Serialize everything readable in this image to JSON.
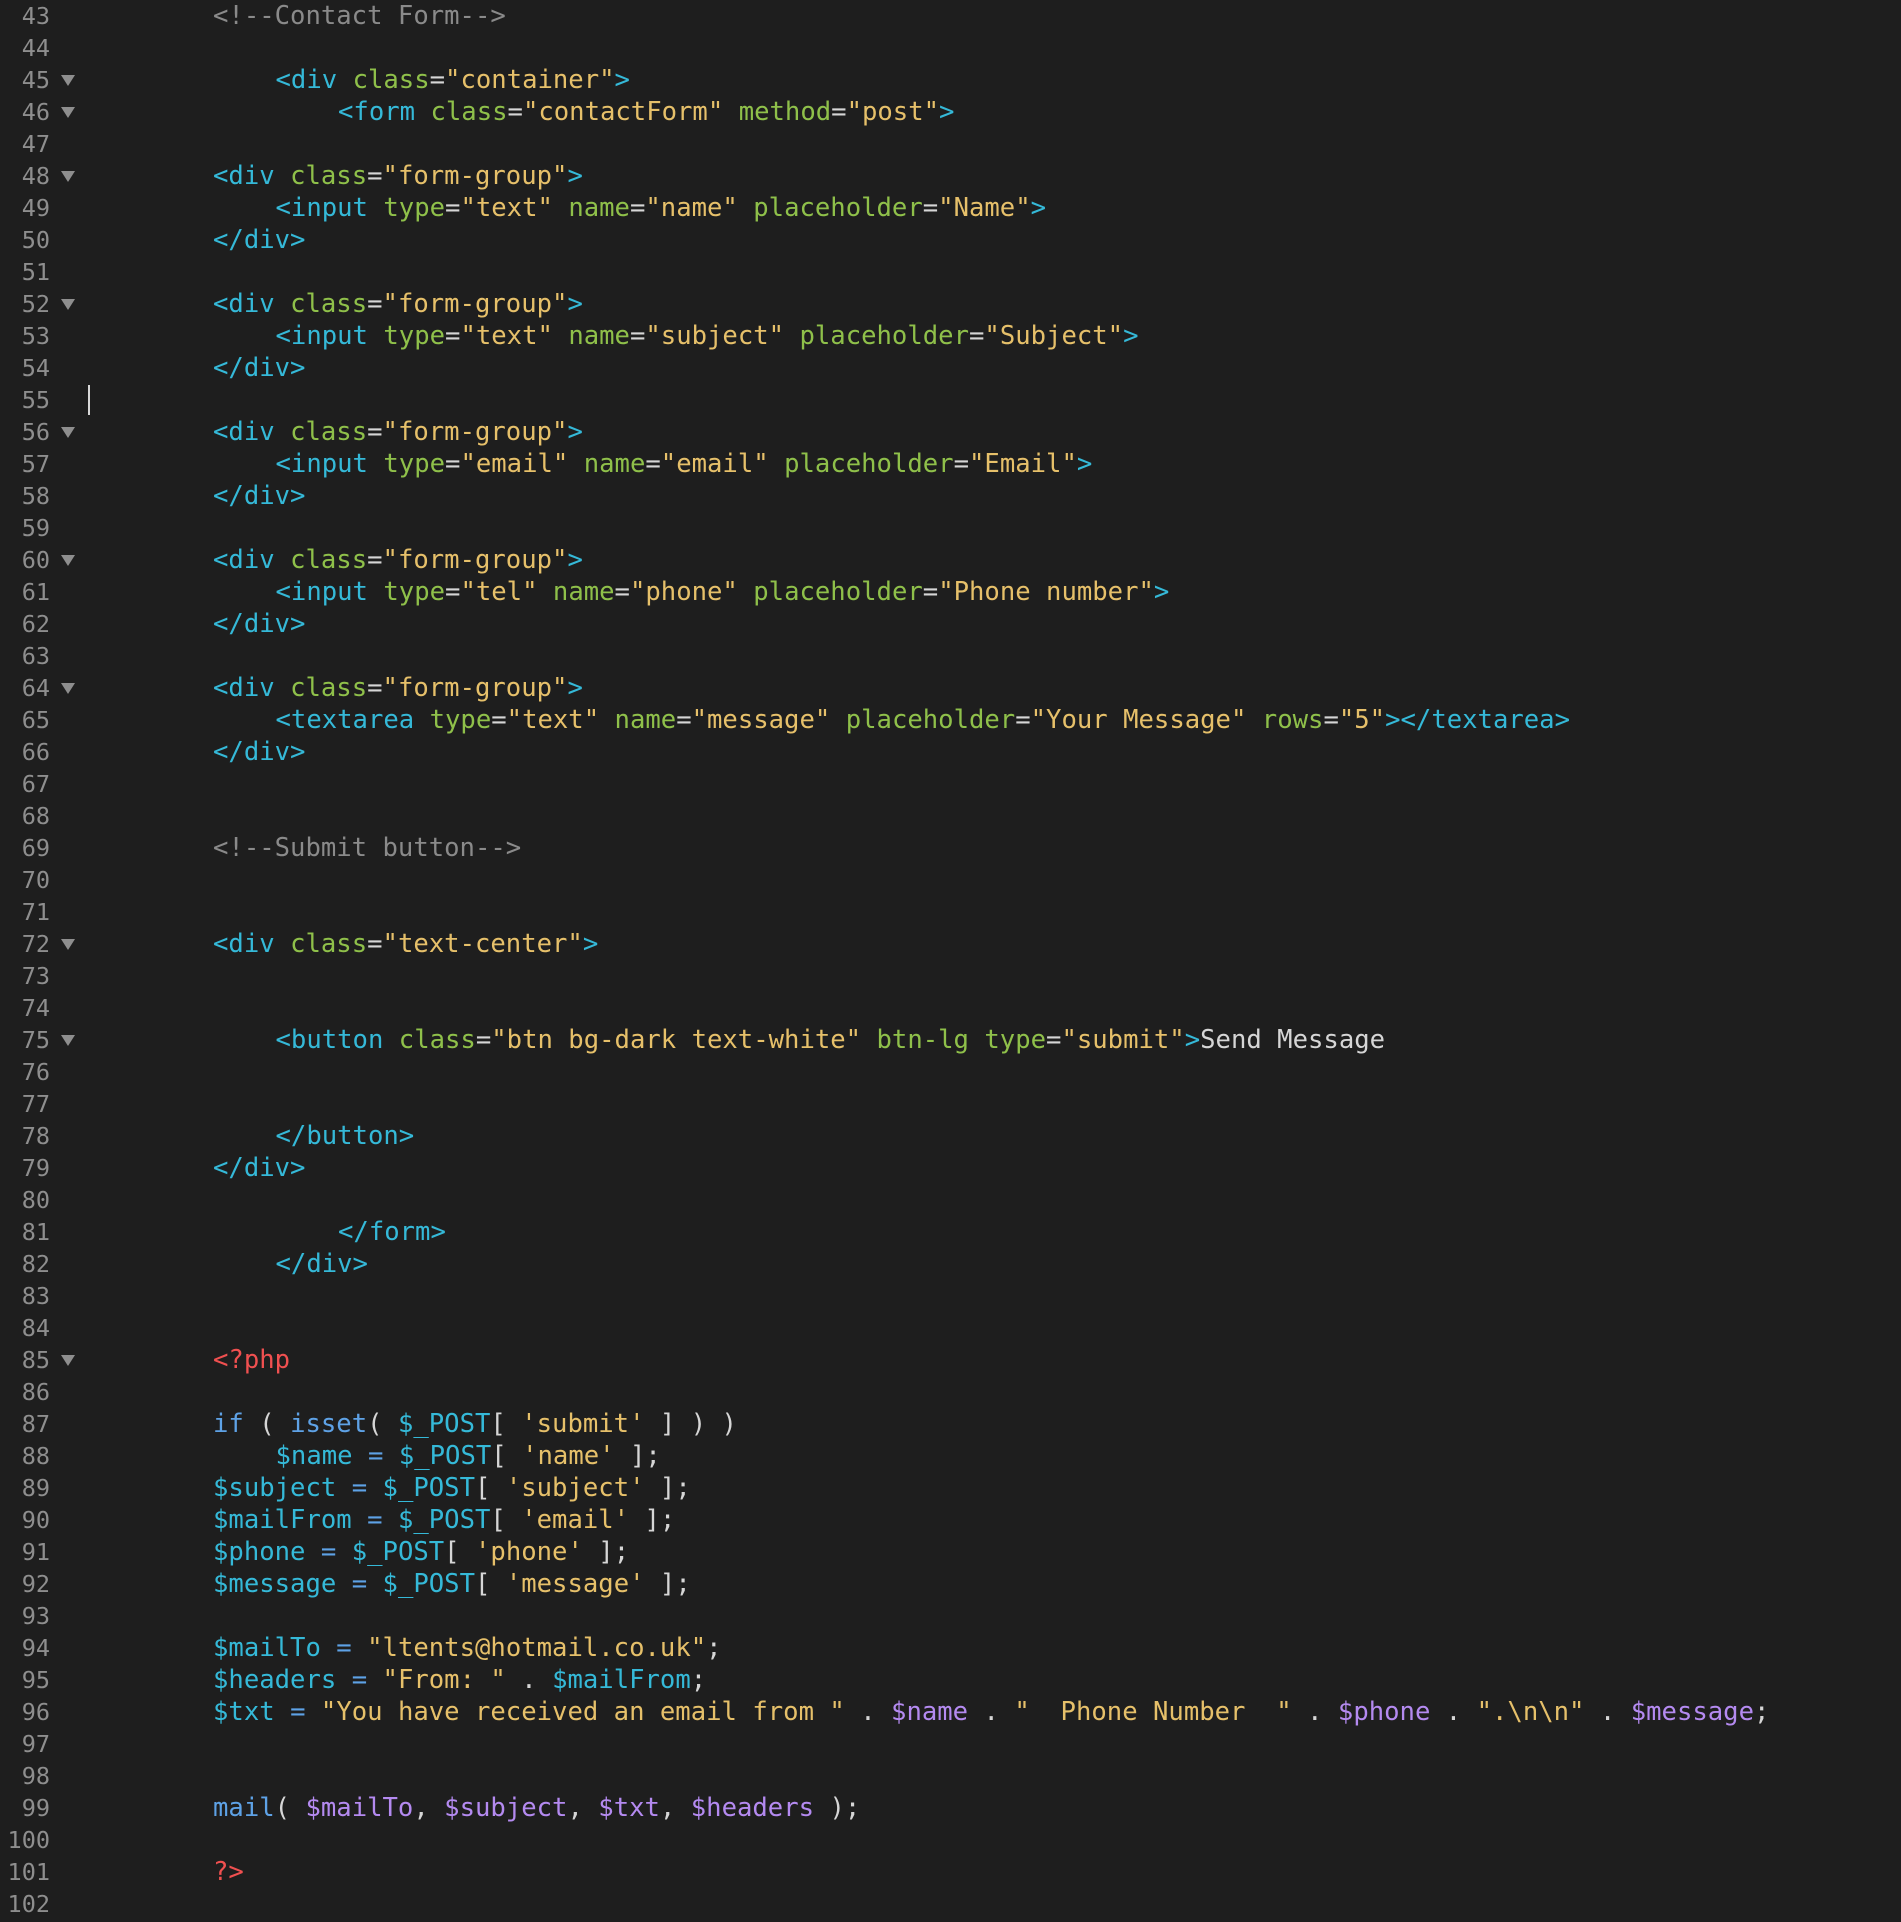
{
  "colors": {
    "background": "#1e1e1e",
    "line_number": "#8e8e8e",
    "plain": "#d6d6d6",
    "comment": "#8a8a8a",
    "tag": "#35b9d8",
    "attribute": "#8fc04a",
    "string": "#e6c06a",
    "php_tag": "#f05050",
    "keyword": "#5ea2e6",
    "variable": "#b48af0"
  },
  "lines": [
    {
      "number": "43",
      "indent": 2,
      "fold": false,
      "tokens": [
        [
          "c",
          "<!--Contact Form-->"
        ]
      ]
    },
    {
      "number": "44",
      "indent": 0,
      "fold": false,
      "tokens": []
    },
    {
      "number": "45",
      "indent": 3,
      "fold": true,
      "tokens": [
        [
          "t",
          "<div"
        ],
        [
          "p",
          " "
        ],
        [
          "a",
          "class"
        ],
        [
          "p",
          "="
        ],
        [
          "s",
          "\"container\""
        ],
        [
          "t",
          ">"
        ]
      ]
    },
    {
      "number": "46",
      "indent": 4,
      "fold": true,
      "tokens": [
        [
          "t",
          "<form"
        ],
        [
          "p",
          " "
        ],
        [
          "a",
          "class"
        ],
        [
          "p",
          "="
        ],
        [
          "s",
          "\"contactForm\""
        ],
        [
          "p",
          " "
        ],
        [
          "a",
          "method"
        ],
        [
          "p",
          "="
        ],
        [
          "s",
          "\"post\""
        ],
        [
          "t",
          ">"
        ]
      ]
    },
    {
      "number": "47",
      "indent": 0,
      "fold": false,
      "tokens": []
    },
    {
      "number": "48",
      "indent": 2,
      "fold": true,
      "tokens": [
        [
          "t",
          "<div"
        ],
        [
          "p",
          " "
        ],
        [
          "a",
          "class"
        ],
        [
          "p",
          "="
        ],
        [
          "s",
          "\"form-group\""
        ],
        [
          "t",
          ">"
        ]
      ]
    },
    {
      "number": "49",
      "indent": 3,
      "fold": false,
      "tokens": [
        [
          "t",
          "<input"
        ],
        [
          "p",
          " "
        ],
        [
          "a",
          "type"
        ],
        [
          "p",
          "="
        ],
        [
          "s",
          "\"text\""
        ],
        [
          "p",
          " "
        ],
        [
          "a",
          "name"
        ],
        [
          "p",
          "="
        ],
        [
          "s",
          "\"name\""
        ],
        [
          "p",
          " "
        ],
        [
          "a",
          "placeholder"
        ],
        [
          "p",
          "="
        ],
        [
          "s",
          "\"Name\""
        ],
        [
          "t",
          ">"
        ]
      ]
    },
    {
      "number": "50",
      "indent": 2,
      "fold": false,
      "tokens": [
        [
          "t",
          "</div>"
        ]
      ]
    },
    {
      "number": "51",
      "indent": 0,
      "fold": false,
      "tokens": []
    },
    {
      "number": "52",
      "indent": 2,
      "fold": true,
      "tokens": [
        [
          "t",
          "<div"
        ],
        [
          "p",
          " "
        ],
        [
          "a",
          "class"
        ],
        [
          "p",
          "="
        ],
        [
          "s",
          "\"form-group\""
        ],
        [
          "t",
          ">"
        ]
      ]
    },
    {
      "number": "53",
      "indent": 3,
      "fold": false,
      "tokens": [
        [
          "t",
          "<input"
        ],
        [
          "p",
          " "
        ],
        [
          "a",
          "type"
        ],
        [
          "p",
          "="
        ],
        [
          "s",
          "\"text\""
        ],
        [
          "p",
          " "
        ],
        [
          "a",
          "name"
        ],
        [
          "p",
          "="
        ],
        [
          "s",
          "\"subject\""
        ],
        [
          "p",
          " "
        ],
        [
          "a",
          "placeholder"
        ],
        [
          "p",
          "="
        ],
        [
          "s",
          "\"Subject\""
        ],
        [
          "t",
          ">"
        ]
      ]
    },
    {
      "number": "54",
      "indent": 2,
      "fold": false,
      "tokens": [
        [
          "t",
          "</div>"
        ]
      ]
    },
    {
      "number": "55",
      "indent": 0,
      "fold": false,
      "cursor": true,
      "tokens": []
    },
    {
      "number": "56",
      "indent": 2,
      "fold": true,
      "tokens": [
        [
          "t",
          "<div"
        ],
        [
          "p",
          " "
        ],
        [
          "a",
          "class"
        ],
        [
          "p",
          "="
        ],
        [
          "s",
          "\"form-group\""
        ],
        [
          "t",
          ">"
        ]
      ]
    },
    {
      "number": "57",
      "indent": 3,
      "fold": false,
      "tokens": [
        [
          "t",
          "<input"
        ],
        [
          "p",
          " "
        ],
        [
          "a",
          "type"
        ],
        [
          "p",
          "="
        ],
        [
          "s",
          "\"email\""
        ],
        [
          "p",
          " "
        ],
        [
          "a",
          "name"
        ],
        [
          "p",
          "="
        ],
        [
          "s",
          "\"email\""
        ],
        [
          "p",
          " "
        ],
        [
          "a",
          "placeholder"
        ],
        [
          "p",
          "="
        ],
        [
          "s",
          "\"Email\""
        ],
        [
          "t",
          ">"
        ]
      ]
    },
    {
      "number": "58",
      "indent": 2,
      "fold": false,
      "tokens": [
        [
          "t",
          "</div>"
        ]
      ]
    },
    {
      "number": "59",
      "indent": 0,
      "fold": false,
      "tokens": []
    },
    {
      "number": "60",
      "indent": 2,
      "fold": true,
      "tokens": [
        [
          "t",
          "<div"
        ],
        [
          "p",
          " "
        ],
        [
          "a",
          "class"
        ],
        [
          "p",
          "="
        ],
        [
          "s",
          "\"form-group\""
        ],
        [
          "t",
          ">"
        ]
      ]
    },
    {
      "number": "61",
      "indent": 3,
      "fold": false,
      "tokens": [
        [
          "t",
          "<input"
        ],
        [
          "p",
          " "
        ],
        [
          "a",
          "type"
        ],
        [
          "p",
          "="
        ],
        [
          "s",
          "\"tel\""
        ],
        [
          "p",
          " "
        ],
        [
          "a",
          "name"
        ],
        [
          "p",
          "="
        ],
        [
          "s",
          "\"phone\""
        ],
        [
          "p",
          " "
        ],
        [
          "a",
          "placeholder"
        ],
        [
          "p",
          "="
        ],
        [
          "s",
          "\"Phone number\""
        ],
        [
          "t",
          ">"
        ]
      ]
    },
    {
      "number": "62",
      "indent": 2,
      "fold": false,
      "tokens": [
        [
          "t",
          "</div>"
        ]
      ]
    },
    {
      "number": "63",
      "indent": 0,
      "fold": false,
      "tokens": []
    },
    {
      "number": "64",
      "indent": 2,
      "fold": true,
      "tokens": [
        [
          "t",
          "<div"
        ],
        [
          "p",
          " "
        ],
        [
          "a",
          "class"
        ],
        [
          "p",
          "="
        ],
        [
          "s",
          "\"form-group\""
        ],
        [
          "t",
          ">"
        ]
      ]
    },
    {
      "number": "65",
      "indent": 3,
      "fold": false,
      "tokens": [
        [
          "t",
          "<textarea"
        ],
        [
          "p",
          " "
        ],
        [
          "a",
          "type"
        ],
        [
          "p",
          "="
        ],
        [
          "s",
          "\"text\""
        ],
        [
          "p",
          " "
        ],
        [
          "a",
          "name"
        ],
        [
          "p",
          "="
        ],
        [
          "s",
          "\"message\""
        ],
        [
          "p",
          " "
        ],
        [
          "a",
          "placeholder"
        ],
        [
          "p",
          "="
        ],
        [
          "s",
          "\"Your Message\""
        ],
        [
          "p",
          " "
        ],
        [
          "a",
          "rows"
        ],
        [
          "p",
          "="
        ],
        [
          "s",
          "\"5\""
        ],
        [
          "t",
          "></textarea>"
        ]
      ]
    },
    {
      "number": "66",
      "indent": 2,
      "fold": false,
      "tokens": [
        [
          "t",
          "</div>"
        ]
      ]
    },
    {
      "number": "67",
      "indent": 0,
      "fold": false,
      "tokens": []
    },
    {
      "number": "68",
      "indent": 0,
      "fold": false,
      "tokens": []
    },
    {
      "number": "69",
      "indent": 2,
      "fold": false,
      "tokens": [
        [
          "c",
          "<!--Submit button-->"
        ]
      ]
    },
    {
      "number": "70",
      "indent": 0,
      "fold": false,
      "tokens": []
    },
    {
      "number": "71",
      "indent": 0,
      "fold": false,
      "tokens": []
    },
    {
      "number": "72",
      "indent": 2,
      "fold": true,
      "tokens": [
        [
          "t",
          "<div"
        ],
        [
          "p",
          " "
        ],
        [
          "a",
          "class"
        ],
        [
          "p",
          "="
        ],
        [
          "s",
          "\"text-center\""
        ],
        [
          "t",
          ">"
        ]
      ]
    },
    {
      "number": "73",
      "indent": 0,
      "fold": false,
      "tokens": []
    },
    {
      "number": "74",
      "indent": 0,
      "fold": false,
      "tokens": []
    },
    {
      "number": "75",
      "indent": 3,
      "fold": true,
      "tokens": [
        [
          "t",
          "<button"
        ],
        [
          "p",
          " "
        ],
        [
          "a",
          "class"
        ],
        [
          "p",
          "="
        ],
        [
          "s",
          "\"btn bg-dark text-white\""
        ],
        [
          "p",
          " "
        ],
        [
          "a",
          "btn-lg"
        ],
        [
          "p",
          " "
        ],
        [
          "a",
          "type"
        ],
        [
          "p",
          "="
        ],
        [
          "s",
          "\"submit\""
        ],
        [
          "t",
          ">"
        ],
        [
          "p",
          "Send Message"
        ]
      ]
    },
    {
      "number": "76",
      "indent": 0,
      "fold": false,
      "tokens": []
    },
    {
      "number": "77",
      "indent": 0,
      "fold": false,
      "tokens": []
    },
    {
      "number": "78",
      "indent": 3,
      "fold": false,
      "tokens": [
        [
          "t",
          "</button>"
        ]
      ]
    },
    {
      "number": "79",
      "indent": 2,
      "fold": false,
      "tokens": [
        [
          "t",
          "</div>"
        ]
      ]
    },
    {
      "number": "80",
      "indent": 0,
      "fold": false,
      "tokens": []
    },
    {
      "number": "81",
      "indent": 4,
      "fold": false,
      "tokens": [
        [
          "t",
          "</form>"
        ]
      ]
    },
    {
      "number": "82",
      "indent": 3,
      "fold": false,
      "tokens": [
        [
          "t",
          "</div>"
        ]
      ]
    },
    {
      "number": "83",
      "indent": 0,
      "fold": false,
      "tokens": []
    },
    {
      "number": "84",
      "indent": 0,
      "fold": false,
      "tokens": []
    },
    {
      "number": "85",
      "indent": 2,
      "fold": true,
      "tokens": [
        [
          "r",
          "<?php"
        ]
      ]
    },
    {
      "number": "86",
      "indent": 0,
      "fold": false,
      "tokens": []
    },
    {
      "number": "87",
      "indent": 2,
      "fold": false,
      "tokens": [
        [
          "k",
          "if"
        ],
        [
          "p",
          " ( "
        ],
        [
          "k",
          "isset"
        ],
        [
          "p",
          "( "
        ],
        [
          "t",
          "$_POST"
        ],
        [
          "p",
          "[ "
        ],
        [
          "s",
          "'submit'"
        ],
        [
          "p",
          " ] ) )"
        ]
      ]
    },
    {
      "number": "88",
      "indent": 3,
      "fold": false,
      "tokens": [
        [
          "t",
          "$name"
        ],
        [
          "p",
          " "
        ],
        [
          "k",
          "="
        ],
        [
          "p",
          " "
        ],
        [
          "t",
          "$_POST"
        ],
        [
          "p",
          "[ "
        ],
        [
          "s",
          "'name'"
        ],
        [
          "p",
          " ];"
        ]
      ]
    },
    {
      "number": "89",
      "indent": 2,
      "fold": false,
      "tokens": [
        [
          "t",
          "$subject"
        ],
        [
          "p",
          " "
        ],
        [
          "k",
          "="
        ],
        [
          "p",
          " "
        ],
        [
          "t",
          "$_POST"
        ],
        [
          "p",
          "[ "
        ],
        [
          "s",
          "'subject'"
        ],
        [
          "p",
          " ];"
        ]
      ]
    },
    {
      "number": "90",
      "indent": 2,
      "fold": false,
      "tokens": [
        [
          "t",
          "$mailFrom"
        ],
        [
          "p",
          " "
        ],
        [
          "k",
          "="
        ],
        [
          "p",
          " "
        ],
        [
          "t",
          "$_POST"
        ],
        [
          "p",
          "[ "
        ],
        [
          "s",
          "'email'"
        ],
        [
          "p",
          " ];"
        ]
      ]
    },
    {
      "number": "91",
      "indent": 2,
      "fold": false,
      "tokens": [
        [
          "t",
          "$phone"
        ],
        [
          "p",
          " "
        ],
        [
          "k",
          "="
        ],
        [
          "p",
          " "
        ],
        [
          "t",
          "$_POST"
        ],
        [
          "p",
          "[ "
        ],
        [
          "s",
          "'phone'"
        ],
        [
          "p",
          " ];"
        ]
      ]
    },
    {
      "number": "92",
      "indent": 2,
      "fold": false,
      "tokens": [
        [
          "t",
          "$message"
        ],
        [
          "p",
          " "
        ],
        [
          "k",
          "="
        ],
        [
          "p",
          " "
        ],
        [
          "t",
          "$_POST"
        ],
        [
          "p",
          "[ "
        ],
        [
          "s",
          "'message'"
        ],
        [
          "p",
          " ];"
        ]
      ]
    },
    {
      "number": "93",
      "indent": 0,
      "fold": false,
      "tokens": []
    },
    {
      "number": "94",
      "indent": 2,
      "fold": false,
      "tokens": [
        [
          "t",
          "$mailTo"
        ],
        [
          "p",
          " "
        ],
        [
          "k",
          "="
        ],
        [
          "p",
          " "
        ],
        [
          "s",
          "\"ltents@hotmail.co.uk\""
        ],
        [
          "p",
          ";"
        ]
      ]
    },
    {
      "number": "95",
      "indent": 2,
      "fold": false,
      "tokens": [
        [
          "t",
          "$headers"
        ],
        [
          "p",
          " "
        ],
        [
          "k",
          "="
        ],
        [
          "p",
          " "
        ],
        [
          "s",
          "\"From: \""
        ],
        [
          "p",
          " . "
        ],
        [
          "t",
          "$mailFrom"
        ],
        [
          "p",
          ";"
        ]
      ]
    },
    {
      "number": "96",
      "indent": 2,
      "fold": false,
      "tokens": [
        [
          "t",
          "$txt"
        ],
        [
          "p",
          " "
        ],
        [
          "k",
          "="
        ],
        [
          "p",
          " "
        ],
        [
          "s",
          "\"You have received an email from \""
        ],
        [
          "p",
          " . "
        ],
        [
          "v",
          "$name"
        ],
        [
          "p",
          " . "
        ],
        [
          "s",
          "\"  Phone Number  \""
        ],
        [
          "p",
          " . "
        ],
        [
          "v",
          "$phone"
        ],
        [
          "p",
          " . "
        ],
        [
          "s",
          "\".\\n\\n\""
        ],
        [
          "p",
          " . "
        ],
        [
          "v",
          "$message"
        ],
        [
          "p",
          ";"
        ]
      ]
    },
    {
      "number": "97",
      "indent": 0,
      "fold": false,
      "tokens": []
    },
    {
      "number": "98",
      "indent": 0,
      "fold": false,
      "tokens": []
    },
    {
      "number": "99",
      "indent": 2,
      "fold": false,
      "tokens": [
        [
          "k",
          "mail"
        ],
        [
          "p",
          "( "
        ],
        [
          "v",
          "$mailTo"
        ],
        [
          "p",
          ", "
        ],
        [
          "v",
          "$subject"
        ],
        [
          "p",
          ", "
        ],
        [
          "v",
          "$txt"
        ],
        [
          "p",
          ", "
        ],
        [
          "v",
          "$headers"
        ],
        [
          "p",
          " );"
        ]
      ]
    },
    {
      "number": "100",
      "indent": 0,
      "fold": false,
      "tokens": []
    },
    {
      "number": "101",
      "indent": 2,
      "fold": false,
      "tokens": [
        [
          "r",
          "?>"
        ]
      ]
    },
    {
      "number": "102",
      "indent": 0,
      "fold": false,
      "tokens": []
    }
  ]
}
